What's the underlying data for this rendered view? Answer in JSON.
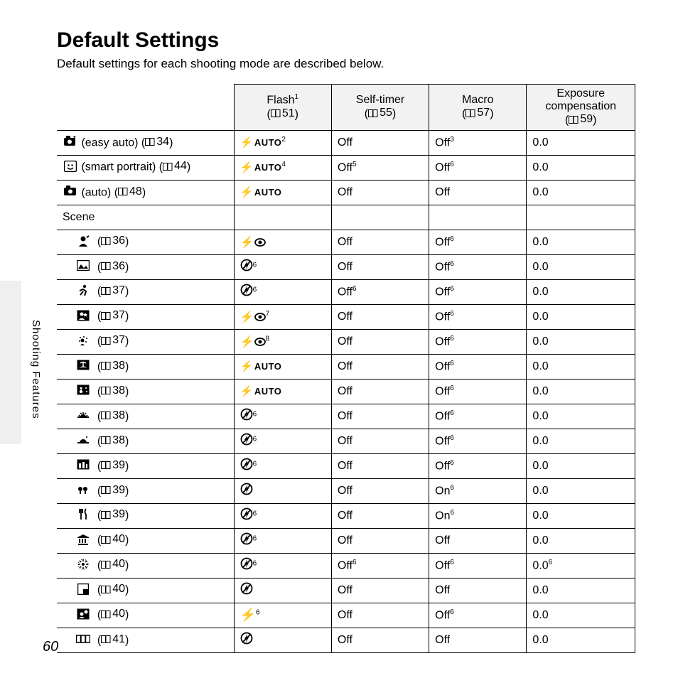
{
  "title": "Default Settings",
  "intro": "Default settings for each shooting mode are described below.",
  "side_label": "Shooting Features",
  "page_number": "60",
  "columns": {
    "c1": {
      "label": "Flash",
      "sup": "1",
      "ref": "51"
    },
    "c2": {
      "label": "Self-timer",
      "sup": "",
      "ref": "55"
    },
    "c3": {
      "label": "Macro",
      "sup": "",
      "ref": "57"
    },
    "c4": {
      "label": "Exposure compensation",
      "sup": "",
      "ref": "59"
    }
  },
  "rows": [
    {
      "kind": "top",
      "icon": "easy-auto-icon",
      "label": " (easy auto) (",
      "ref": "34",
      "tail": ")",
      "flash": {
        "t": "sauto",
        "sup": "2"
      },
      "self": {
        "t": "Off",
        "sup": ""
      },
      "macro": {
        "t": "Off",
        "sup": "3"
      },
      "exp": {
        "t": "0.0",
        "sup": ""
      }
    },
    {
      "kind": "top",
      "icon": "smart-portrait-icon",
      "label": " (smart portrait) (",
      "ref": "44",
      "tail": ")",
      "flash": {
        "t": "sauto",
        "sup": "4"
      },
      "self": {
        "t": "Off",
        "sup": "5"
      },
      "macro": {
        "t": "Off",
        "sup": "6"
      },
      "exp": {
        "t": "0.0",
        "sup": ""
      }
    },
    {
      "kind": "top",
      "icon": "auto-icon",
      "label": " (auto) (",
      "ref": "48",
      "tail": ")",
      "flash": {
        "t": "sauto",
        "sup": ""
      },
      "self": {
        "t": "Off",
        "sup": ""
      },
      "macro": {
        "t": "Off",
        "sup": ""
      },
      "exp": {
        "t": "0.0",
        "sup": ""
      }
    },
    {
      "kind": "scenehdr",
      "label": "Scene"
    },
    {
      "kind": "scene",
      "icon": "portrait-icon",
      "ref": "36",
      "flash": {
        "t": "redeye",
        "sup": ""
      },
      "self": {
        "t": "Off",
        "sup": ""
      },
      "macro": {
        "t": "Off",
        "sup": "6"
      },
      "exp": {
        "t": "0.0",
        "sup": ""
      }
    },
    {
      "kind": "scene",
      "icon": "landscape-icon",
      "ref": "36",
      "flash": {
        "t": "noflash",
        "sup": "6"
      },
      "self": {
        "t": "Off",
        "sup": ""
      },
      "macro": {
        "t": "Off",
        "sup": "6"
      },
      "exp": {
        "t": "0.0",
        "sup": ""
      }
    },
    {
      "kind": "scene",
      "icon": "sports-icon",
      "ref": "37",
      "flash": {
        "t": "noflash",
        "sup": "6"
      },
      "self": {
        "t": "Off",
        "sup": "6"
      },
      "macro": {
        "t": "Off",
        "sup": "6"
      },
      "exp": {
        "t": "0.0",
        "sup": ""
      }
    },
    {
      "kind": "scene",
      "icon": "night-portrait-icon",
      "ref": "37",
      "flash": {
        "t": "redeye",
        "sup": "7"
      },
      "self": {
        "t": "Off",
        "sup": ""
      },
      "macro": {
        "t": "Off",
        "sup": "6"
      },
      "exp": {
        "t": "0.0",
        "sup": ""
      }
    },
    {
      "kind": "scene",
      "icon": "party-icon",
      "ref": "37",
      "flash": {
        "t": "redeye",
        "sup": "8"
      },
      "self": {
        "t": "Off",
        "sup": ""
      },
      "macro": {
        "t": "Off",
        "sup": "6"
      },
      "exp": {
        "t": "0.0",
        "sup": ""
      }
    },
    {
      "kind": "scene",
      "icon": "beach-icon",
      "ref": "38",
      "flash": {
        "t": "sauto",
        "sup": ""
      },
      "self": {
        "t": "Off",
        "sup": ""
      },
      "macro": {
        "t": "Off",
        "sup": "6"
      },
      "exp": {
        "t": "0.0",
        "sup": ""
      }
    },
    {
      "kind": "scene",
      "icon": "snow-icon",
      "ref": "38",
      "flash": {
        "t": "sauto",
        "sup": ""
      },
      "self": {
        "t": "Off",
        "sup": ""
      },
      "macro": {
        "t": "Off",
        "sup": "6"
      },
      "exp": {
        "t": "0.0",
        "sup": ""
      }
    },
    {
      "kind": "scene",
      "icon": "sunset-icon",
      "ref": "38",
      "flash": {
        "t": "noflash",
        "sup": "6"
      },
      "self": {
        "t": "Off",
        "sup": ""
      },
      "macro": {
        "t": "Off",
        "sup": "6"
      },
      "exp": {
        "t": "0.0",
        "sup": ""
      }
    },
    {
      "kind": "scene",
      "icon": "dusk-icon",
      "ref": "38",
      "flash": {
        "t": "noflash",
        "sup": "6"
      },
      "self": {
        "t": "Off",
        "sup": ""
      },
      "macro": {
        "t": "Off",
        "sup": "6"
      },
      "exp": {
        "t": "0.0",
        "sup": ""
      }
    },
    {
      "kind": "scene",
      "icon": "night-landscape-icon",
      "ref": "39",
      "flash": {
        "t": "noflash",
        "sup": "6"
      },
      "self": {
        "t": "Off",
        "sup": ""
      },
      "macro": {
        "t": "Off",
        "sup": "6"
      },
      "exp": {
        "t": "0.0",
        "sup": ""
      }
    },
    {
      "kind": "scene",
      "icon": "closeup-icon",
      "ref": "39",
      "flash": {
        "t": "noflash",
        "sup": ""
      },
      "self": {
        "t": "Off",
        "sup": ""
      },
      "macro": {
        "t": "On",
        "sup": "6"
      },
      "exp": {
        "t": "0.0",
        "sup": ""
      }
    },
    {
      "kind": "scene",
      "icon": "food-icon",
      "ref": "39",
      "flash": {
        "t": "noflash",
        "sup": "6"
      },
      "self": {
        "t": "Off",
        "sup": ""
      },
      "macro": {
        "t": "On",
        "sup": "6"
      },
      "exp": {
        "t": "0.0",
        "sup": ""
      }
    },
    {
      "kind": "scene",
      "icon": "museum-icon",
      "ref": "40",
      "flash": {
        "t": "noflash",
        "sup": "6"
      },
      "self": {
        "t": "Off",
        "sup": ""
      },
      "macro": {
        "t": "Off",
        "sup": ""
      },
      "exp": {
        "t": "0.0",
        "sup": ""
      }
    },
    {
      "kind": "scene",
      "icon": "fireworks-icon",
      "ref": "40",
      "flash": {
        "t": "noflash",
        "sup": "6"
      },
      "self": {
        "t": "Off",
        "sup": "6"
      },
      "macro": {
        "t": "Off",
        "sup": "6"
      },
      "exp": {
        "t": "0.0",
        "sup": "6"
      }
    },
    {
      "kind": "scene",
      "icon": "copy-icon",
      "ref": "40",
      "flash": {
        "t": "noflash",
        "sup": ""
      },
      "self": {
        "t": "Off",
        "sup": ""
      },
      "macro": {
        "t": "Off",
        "sup": ""
      },
      "exp": {
        "t": "0.0",
        "sup": ""
      }
    },
    {
      "kind": "scene",
      "icon": "backlight-icon",
      "ref": "40",
      "flash": {
        "t": "fill",
        "sup": "6"
      },
      "self": {
        "t": "Off",
        "sup": ""
      },
      "macro": {
        "t": "Off",
        "sup": "6"
      },
      "exp": {
        "t": "0.0",
        "sup": ""
      }
    },
    {
      "kind": "scene",
      "icon": "panorama-icon",
      "ref": "41",
      "flash": {
        "t": "noflash",
        "sup": ""
      },
      "self": {
        "t": "Off",
        "sup": ""
      },
      "macro": {
        "t": "Off",
        "sup": ""
      },
      "exp": {
        "t": "0.0",
        "sup": ""
      },
      "last": true
    }
  ]
}
